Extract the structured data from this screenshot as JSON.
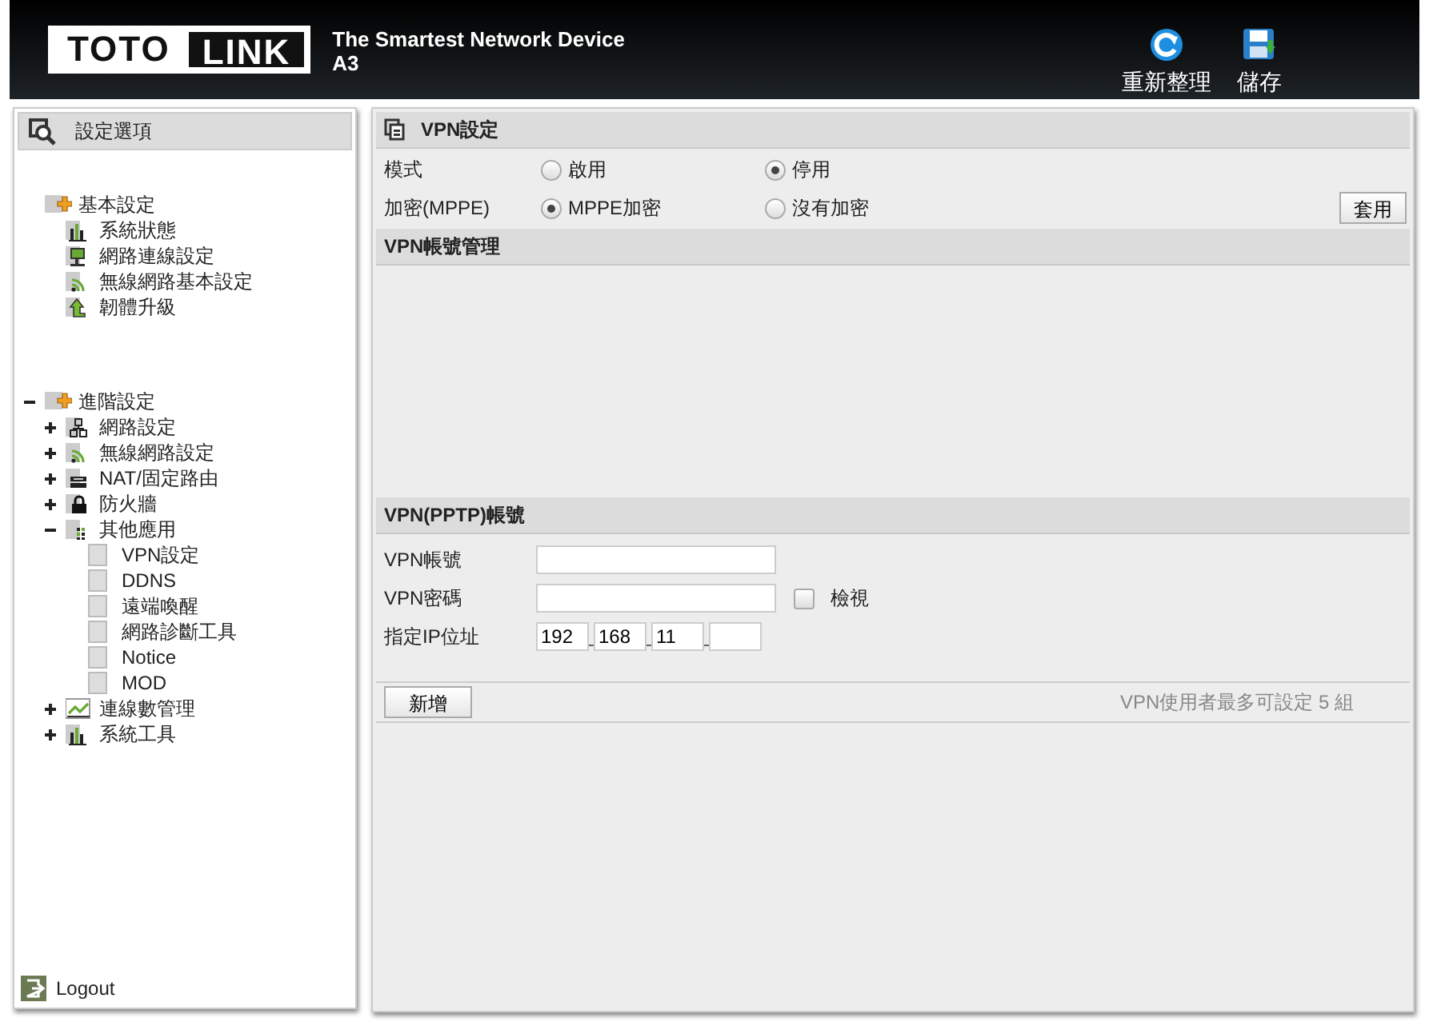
{
  "header": {
    "logo_left": "TOTO",
    "logo_right": "LINK",
    "tagline": "The Smartest Network Device",
    "model": "A3",
    "actions": [
      {
        "kind": "refresh",
        "label": "重新整理"
      },
      {
        "kind": "save",
        "label": "儲存"
      }
    ]
  },
  "sidebar": {
    "title": "設定選項",
    "tree": [
      {
        "label": "基本設定",
        "kind": "group",
        "children": [
          {
            "label": "系統狀態",
            "kind": "chart"
          },
          {
            "label": "網路連線設定",
            "kind": "monitor"
          },
          {
            "label": "無線網路基本設定",
            "kind": "wifi"
          },
          {
            "label": "韌體升級",
            "kind": "upgrade"
          }
        ]
      },
      {
        "label": "進階設定",
        "kind": "group",
        "expanded": true,
        "children": [
          {
            "label": "網路設定",
            "kind": "network",
            "expanded": false
          },
          {
            "label": "無線網路設定",
            "kind": "wifi",
            "expanded": false
          },
          {
            "label": "NAT/固定路由",
            "kind": "router",
            "expanded": false
          },
          {
            "label": "防火牆",
            "kind": "lock",
            "expanded": false
          },
          {
            "label": "其他應用",
            "kind": "grid",
            "expanded": true,
            "children": [
              {
                "label": "VPN設定",
                "kind": "page"
              },
              {
                "label": "DDNS",
                "kind": "page"
              },
              {
                "label": "遠端喚醒",
                "kind": "page"
              },
              {
                "label": "網路診斷工具",
                "kind": "page"
              },
              {
                "label": "Notice",
                "kind": "page"
              },
              {
                "label": "MOD",
                "kind": "page"
              }
            ]
          },
          {
            "label": "連線數管理",
            "kind": "trend",
            "expanded": false
          },
          {
            "label": "系統工具",
            "kind": "chart",
            "expanded": false
          }
        ]
      }
    ],
    "logout": "Logout"
  },
  "main": {
    "title": "VPN設定",
    "settings": [
      {
        "label": "模式",
        "options": [
          {
            "label": "啟用",
            "selected": false
          },
          {
            "label": "停用",
            "selected": true
          }
        ]
      },
      {
        "label": "加密(MPPE)",
        "options": [
          {
            "label": "MPPE加密",
            "selected": true
          },
          {
            "label": "沒有加密",
            "selected": false
          }
        ]
      }
    ],
    "apply_button": "套用",
    "accounts_title": "VPN帳號管理",
    "form_title": "VPN(PPTP)帳號",
    "username_label": "VPN帳號",
    "password_label": "VPN密碼",
    "show_password": {
      "label": "檢視",
      "checked": false
    },
    "ip_label": "指定IP位址",
    "ip_parts": [
      {
        "kind": "octet",
        "value": "192"
      },
      {
        "kind": "octet",
        "value": "168"
      },
      {
        "kind": "octet",
        "value": "11"
      },
      {
        "kind": "octet"
      }
    ],
    "add_button": "新增",
    "note": "VPN使用者最多可設定 5 組"
  }
}
